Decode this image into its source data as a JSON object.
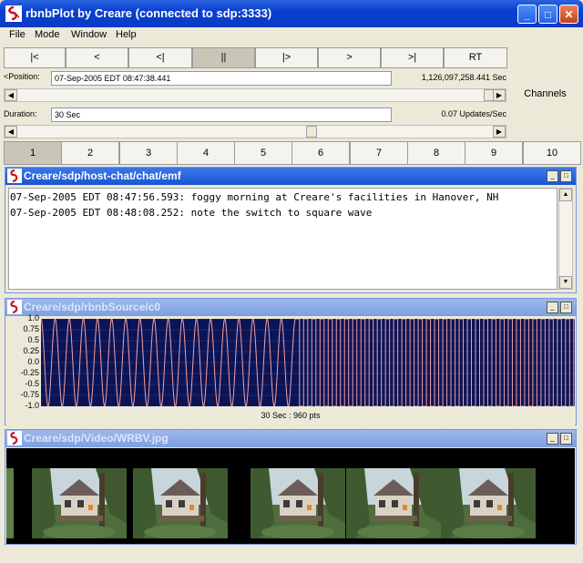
{
  "window": {
    "title": "rbnbPlot by Creare (connected to sdp:3333)"
  },
  "menu": [
    "File",
    "Mode",
    "Window",
    "Help"
  ],
  "playback": {
    "buttons": [
      "|<",
      "<",
      "<|",
      "||",
      "|>",
      ">",
      ">|",
      "RT"
    ],
    "pressed_index": 3
  },
  "position": {
    "label": "<Position:",
    "value": "07-Sep-2005 EDT 08:47:38.441",
    "seconds": "1,126,097,258.441 Sec",
    "scroll_fraction": 1.0
  },
  "duration": {
    "label": "Duration:",
    "value": "30 Sec",
    "rate": "0.07 Updates/Sec",
    "scroll_fraction": 0.62
  },
  "channels_label": "Channels",
  "tabs": {
    "labels": [
      "1",
      "2",
      "3",
      "4",
      "5",
      "6",
      "7",
      "8",
      "9",
      "10"
    ],
    "selected_index": 0
  },
  "panels": {
    "chat": {
      "title": "Creare/sdp/host-chat/chat/emf",
      "lines": [
        "07-Sep-2005 EDT 08:47:56.593: foggy morning at Creare's facilities in Hanover, NH",
        "07-Sep-2005 EDT 08:48:08.252: note the switch to square wave"
      ]
    },
    "plot": {
      "title": "Creare/sdp/rbnbSource/c0",
      "footer": "30 Sec : 960 pts",
      "y_ticks": [
        "1.0",
        "0.75",
        "0.5",
        "0.25",
        "0.0",
        "-0.25",
        "-0.5",
        "-0.75",
        "-1.0"
      ]
    },
    "video": {
      "title": "Creare/sdp/Video/WRBV.jpg"
    }
  },
  "chart_data": {
    "type": "line",
    "title": "",
    "xlabel": "30 Sec : 960 pts",
    "ylabel": "",
    "ylim": [
      -1.0,
      1.0
    ],
    "xlim": [
      0,
      30
    ],
    "series": [
      {
        "waveform": "sine",
        "x_range": [
          0,
          14.3
        ],
        "cycles": 18,
        "amplitude": 1.0
      },
      {
        "waveform": "square",
        "x_range": [
          14.3,
          30
        ],
        "amplitude": 1.0
      }
    ],
    "grid": true,
    "colors": {
      "background": "#0b1457",
      "line": "#f3a0a0"
    }
  },
  "colors": {
    "title_active": "#1a54d6",
    "title_inactive": "#7e9fe0",
    "face": "#ece9d8"
  }
}
